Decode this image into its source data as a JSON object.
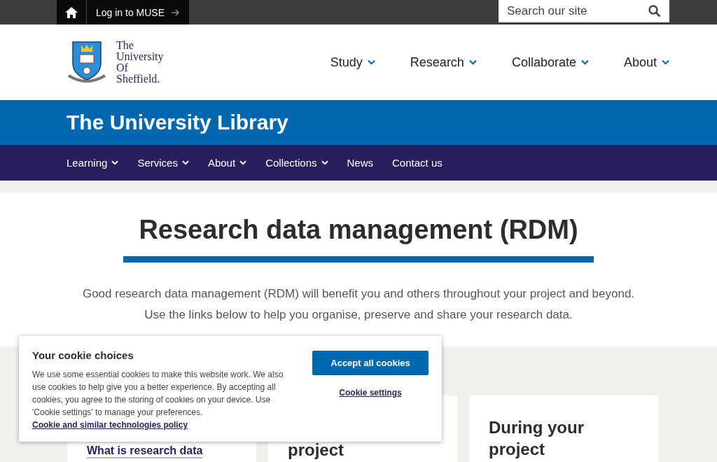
{
  "top_bar": {
    "login_link": "Log in to MUSE",
    "search": {
      "placeholder": "Search our site"
    }
  },
  "logo": {
    "lines": [
      "The",
      "University",
      "Of",
      "Sheffield."
    ]
  },
  "main_nav": [
    {
      "label": "Study"
    },
    {
      "label": "Research"
    },
    {
      "label": "Collaborate"
    },
    {
      "label": "About"
    }
  ],
  "section_title": "The University Library",
  "section_nav": [
    {
      "label": "Learning",
      "dropdown": true
    },
    {
      "label": "Services",
      "dropdown": true
    },
    {
      "label": "About",
      "dropdown": true
    },
    {
      "label": "Collections",
      "dropdown": true
    },
    {
      "label": "News",
      "dropdown": false
    },
    {
      "label": "Contact us",
      "dropdown": false
    }
  ],
  "page_title": "Research data management (RDM)",
  "intro": "Good research data management (RDM) will benefit you and others throughout your project and beyond. Use the links below to help you organise, preserve and share your research data.",
  "cards": [
    {
      "kind": "link",
      "text": "What is research data"
    },
    {
      "kind": "heading",
      "text": "project"
    },
    {
      "kind": "heading",
      "text": "During your project"
    }
  ],
  "cookie_banner": {
    "title": "Your cookie choices",
    "body": "We use some essential cookies to make this website work. We also use cookies to help give you a better experience. By accepting all cookies, you agree to the storing of cookies on your device. Use 'Cookie settings' to manage your preferences.",
    "policy_link": "Cookie and similar technologies policy",
    "accept_button": "Accept all cookies",
    "settings_link": "Cookie settings"
  }
}
